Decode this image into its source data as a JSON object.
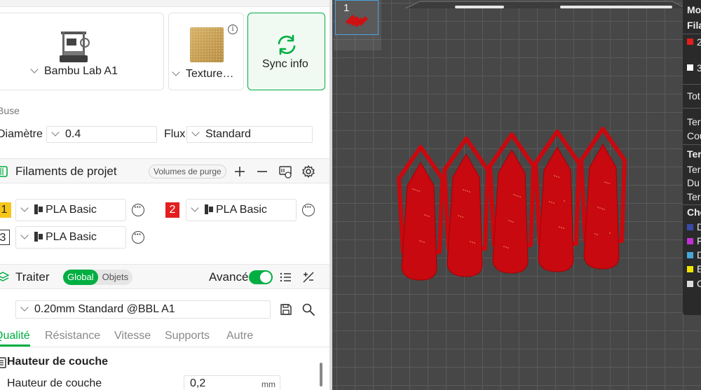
{
  "printer": {
    "name": "Bambu Lab A1",
    "plate": "Texture…",
    "sync_label": "Sync info"
  },
  "nozzle": {
    "section": "Buse",
    "diameter_label": "Diamètre",
    "diameter_value": "0.4",
    "flow_label": "Flux",
    "flow_value": "Standard"
  },
  "filaments": {
    "title": "Filaments de projet",
    "purge_label": "Volumes de purge",
    "items": [
      {
        "num": "1",
        "name": "PLA Basic",
        "color": "#f5c518"
      },
      {
        "num": "2",
        "name": "PLA Basic",
        "color": "#e31e1e"
      },
      {
        "num": "3",
        "name": "PLA Basic",
        "color": "#ffffff"
      }
    ]
  },
  "process": {
    "title": "Traiter",
    "toggle_global": "Global",
    "toggle_objects": "Objets",
    "advanced_label": "Avancé",
    "preset": "0.20mm Standard @BBL A1",
    "tabs": [
      "Qualité",
      "Résistance",
      "Vitesse",
      "Supports",
      "Autre"
    ],
    "group_title": "Hauteur de couche",
    "layer_height_label": "Hauteur de couche",
    "layer_height_value": "0,2",
    "layer_height_unit": "mm"
  },
  "viewport": {
    "plate_number": "1",
    "model_color": "#c8090f",
    "overlay": {
      "l1": "Mo",
      "l2": "Fila",
      "l3": "2",
      "l4": "3",
      "l5": "Tot",
      "l6": "Ter",
      "l7": "Cou",
      "l8": "Ter",
      "l9": "Ter",
      "l10": "Du",
      "l11": "Ter",
      "l12": "Che",
      "l13": "D",
      "l14": "F",
      "l15": "D",
      "l16": "E",
      "l17": "C"
    }
  },
  "colors": {
    "accent": "#00ae42",
    "model": "#c8090f"
  }
}
